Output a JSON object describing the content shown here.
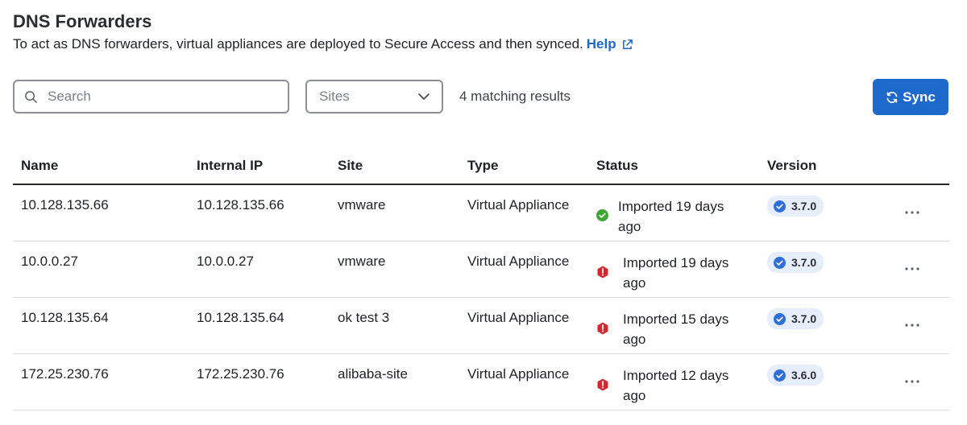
{
  "header": {
    "title": "DNS Forwarders",
    "subtitle": "To act as DNS forwarders, virtual appliances are deployed to Secure Access and then synced.",
    "help_label": "Help"
  },
  "toolbar": {
    "search_placeholder": "Search",
    "sites_placeholder": "Sites",
    "results_text": "4 matching results",
    "sync_label": "Sync"
  },
  "table": {
    "columns": {
      "name": "Name",
      "internal_ip": "Internal IP",
      "site": "Site",
      "type": "Type",
      "status": "Status",
      "version": "Version"
    },
    "rows": [
      {
        "name": "10.128.135.66",
        "internal_ip": "10.128.135.66",
        "site": "vmware",
        "type": "Virtual Appliance",
        "status": "Imported 19 days ago",
        "status_level": "success",
        "version": "3.7.0"
      },
      {
        "name": "10.0.0.27",
        "internal_ip": "10.0.0.27",
        "site": "vmware",
        "type": "Virtual Appliance",
        "status": "Imported 19 days ago",
        "status_level": "error",
        "version": "3.7.0"
      },
      {
        "name": "10.128.135.64",
        "internal_ip": "10.128.135.64",
        "site": "ok test 3",
        "type": "Virtual Appliance",
        "status": "Imported 15 days ago",
        "status_level": "error",
        "version": "3.7.0"
      },
      {
        "name": "172.25.230.76",
        "internal_ip": "172.25.230.76",
        "site": "alibaba-site",
        "type": "Virtual Appliance",
        "status": "Imported 12 days ago",
        "status_level": "error",
        "version": "3.6.0"
      }
    ]
  },
  "icons": {
    "search": "search-icon",
    "chevron": "chevron-down-icon",
    "sync": "sync-icon",
    "external_link": "external-link-icon",
    "status_success": "check-circle-icon",
    "status_error": "error-octagon-icon",
    "version_check": "check-circle-icon",
    "row_menu": "more-horizontal-icon"
  },
  "colors": {
    "accent": "#1d69cc",
    "success": "#3fa535",
    "error": "#d6262f",
    "badge_bg": "#e6eefb",
    "badge_check": "#2f6fd6"
  }
}
